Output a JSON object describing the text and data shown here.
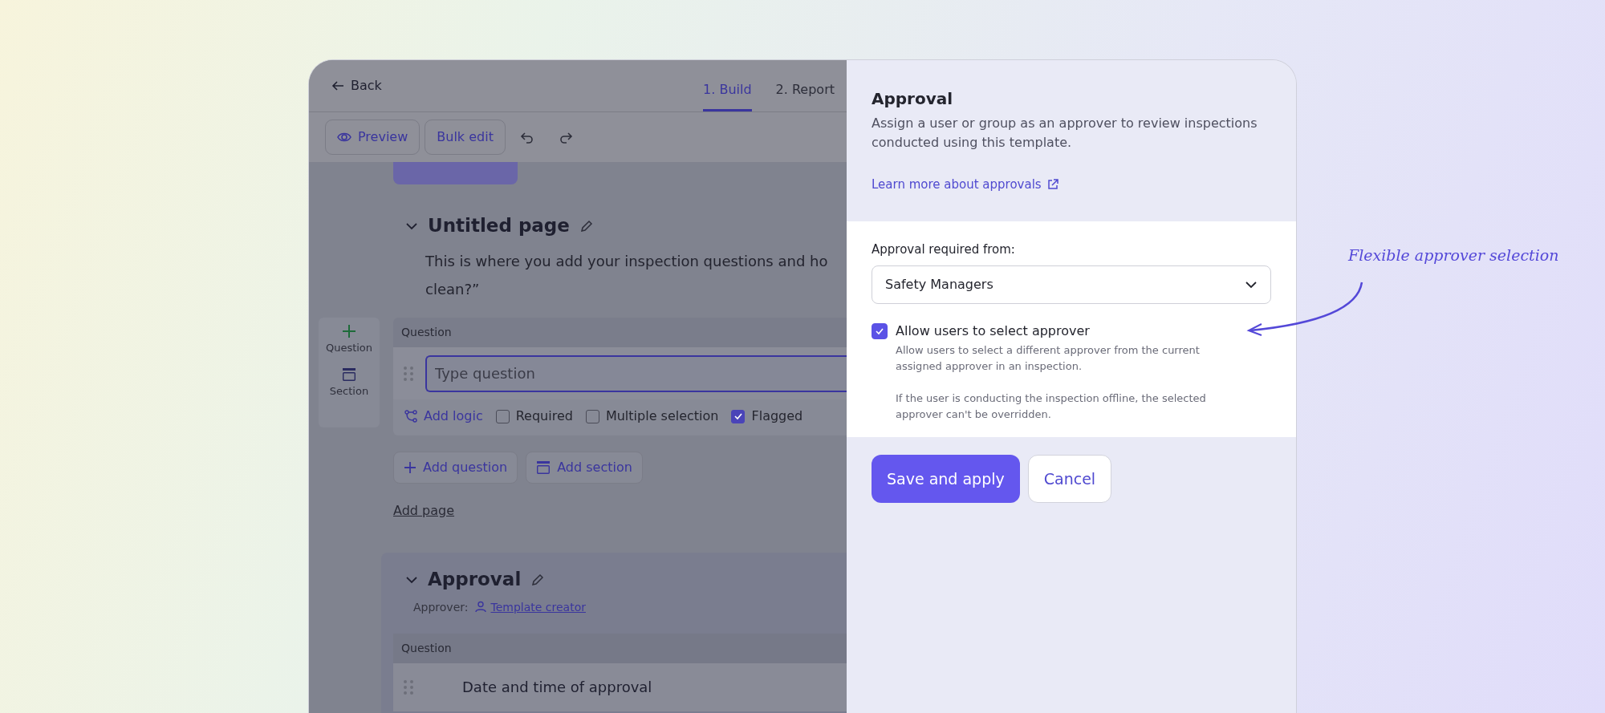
{
  "editor": {
    "back": "Back",
    "tabs": [
      {
        "label": "1. Build",
        "selected": true
      },
      {
        "label": "2. Report",
        "selected": false
      }
    ],
    "toolbar": [
      {
        "kind": "preview",
        "label": "Preview"
      },
      {
        "kind": "plain",
        "label": "Bulk edit"
      }
    ],
    "page": {
      "title": "Untitled page",
      "description_lines": [
        "This is where you add your inspection questions and ho",
        "clean?”"
      ]
    },
    "add_panel": [
      {
        "kind": "question",
        "label": "Question"
      },
      {
        "kind": "section",
        "label": "Section"
      }
    ],
    "question": {
      "label": "Question",
      "placeholder": "Type question",
      "options": [
        {
          "kind": "logic",
          "label": "Add logic"
        },
        {
          "kind": "checkbox",
          "label": "Required",
          "checked": false
        },
        {
          "kind": "checkbox",
          "label": "Multiple selection",
          "checked": false
        },
        {
          "kind": "checkbox",
          "label": "Flagged",
          "checked": true
        }
      ]
    },
    "add_buttons": [
      {
        "kind": "question",
        "label": "Add question"
      },
      {
        "kind": "section",
        "label": "Add section"
      }
    ],
    "add_page": "Add page",
    "approval": {
      "title": "Approval",
      "approver_label": "Approver:",
      "approver": "Template creator",
      "question_label": "Question",
      "question": "Date and time of approval"
    }
  },
  "panel": {
    "title": "Approval",
    "description": "Assign a user or group as an approver to review inspections conducted using this template.",
    "link": "Learn more about approvals",
    "field_label": "Approval required from:",
    "select_value": "Safety Managers",
    "allow": {
      "label": "Allow users to select approver",
      "checked": true,
      "help": [
        "Allow users to select a different approver from the current assigned approver in an inspection.",
        "If the user is conducting the inspection offline, the selected approver can't be overridden."
      ]
    },
    "buttons": [
      {
        "kind": "primary",
        "label": "Save and apply"
      },
      {
        "kind": "secondary",
        "label": "Cancel"
      }
    ]
  },
  "annotation": {
    "text": "Flexible approver selection"
  }
}
